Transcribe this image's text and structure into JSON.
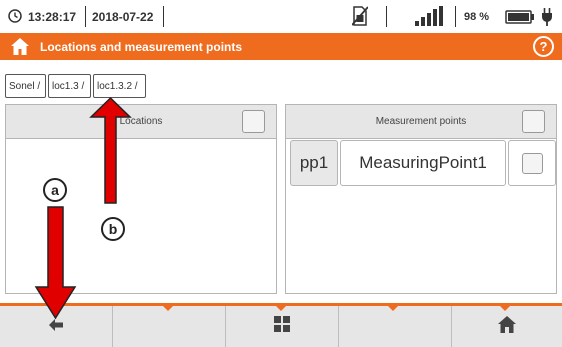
{
  "status_bar": {
    "time": "13:28:17",
    "date": "2018-07-22",
    "battery_percent": "98 %"
  },
  "title_bar": {
    "title": "Locations and measurement points",
    "help_label": "?"
  },
  "breadcrumb": [
    "Sonel /",
    "loc1.3 /",
    "loc1.3.2 /"
  ],
  "locations_panel": {
    "header": "Locations"
  },
  "measurement_points_panel": {
    "header": "Measurement points",
    "items": [
      {
        "id": "pp1",
        "name": "MeasuringPoint1"
      }
    ]
  },
  "annotations": {
    "a": "a",
    "b": "b"
  },
  "colors": {
    "accent": "#ef6b1e",
    "arrow": "#e00000",
    "panel_header": "#e6e6e6",
    "bottom_bar": "#e6e6e6"
  },
  "icons": {
    "status": [
      "clock-icon",
      "no-sim-icon",
      "signal-icon",
      "battery-icon",
      "plug-icon"
    ],
    "title": "home-icon",
    "bottom_bar": [
      "back-arrow-icon",
      "grid-icon",
      "home-icon"
    ]
  }
}
